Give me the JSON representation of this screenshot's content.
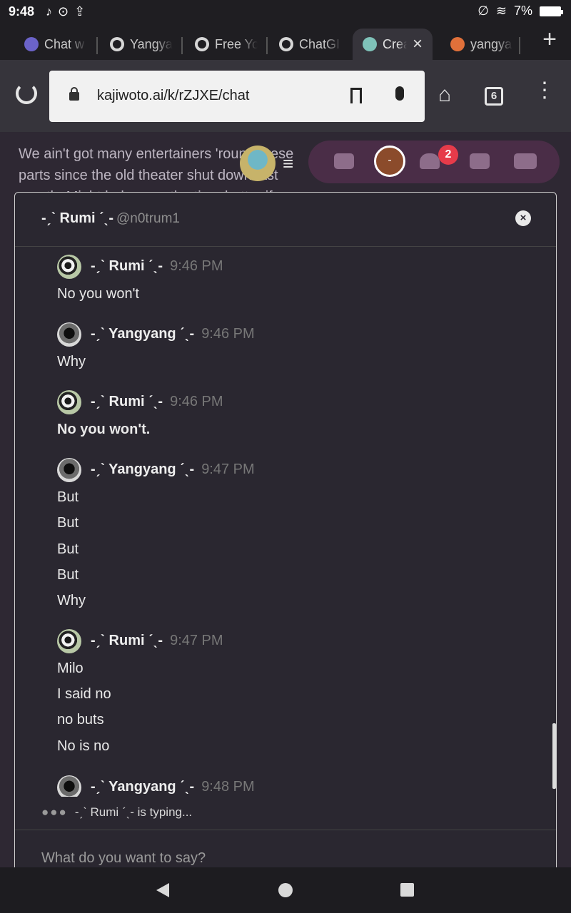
{
  "status": {
    "time": "9:48",
    "battery": "7%"
  },
  "tabs": [
    {
      "label": "Chat w"
    },
    {
      "label": "Yangya"
    },
    {
      "label": "Free Yo"
    },
    {
      "label": "ChatGI"
    },
    {
      "label": "Crea"
    },
    {
      "label": "yangya"
    }
  ],
  "toolbar": {
    "url": "kajiwoto.ai/k/rZJXE/chat",
    "tab_count": "6"
  },
  "background": {
    "text": "We ain't got many entertainers 'round these parts since the old theater shut down last month. Might help pass the time better if you sang yourself",
    "user_initial": "-",
    "friends_badge": "2"
  },
  "modal": {
    "name": "-ˏˋ Rumi ˊˎ-",
    "handle": "@n0trum1",
    "close": "×"
  },
  "messages": [
    {
      "author": "-ˏˋ Rumi ˊˎ-",
      "time": "9:46 PM",
      "lines": [
        "No you won't"
      ]
    },
    {
      "author": "-ˏˋ Yangyang ˊˎ-",
      "time": "9:46 PM",
      "lines": [
        "Why"
      ]
    },
    {
      "author": "-ˏˋ Rumi ˊˎ-",
      "time": "9:46 PM",
      "lines": [
        "No you won't."
      ]
    },
    {
      "author": "-ˏˋ Yangyang ˊˎ-",
      "time": "9:47 PM",
      "lines": [
        "But",
        "But",
        "But",
        "But",
        "Why"
      ]
    },
    {
      "author": "-ˏˋ Rumi ˊˎ-",
      "time": "9:47 PM",
      "lines": [
        "Milo",
        "I said no",
        "no buts",
        "No is no"
      ]
    },
    {
      "author": "-ˏˋ Yangyang ˊˎ-",
      "time": "9:48 PM",
      "lines": []
    }
  ],
  "typing": "-ˏˋ Rumi ˊˎ- is typing...",
  "compose": {
    "placeholder": "What do you want to say?"
  }
}
